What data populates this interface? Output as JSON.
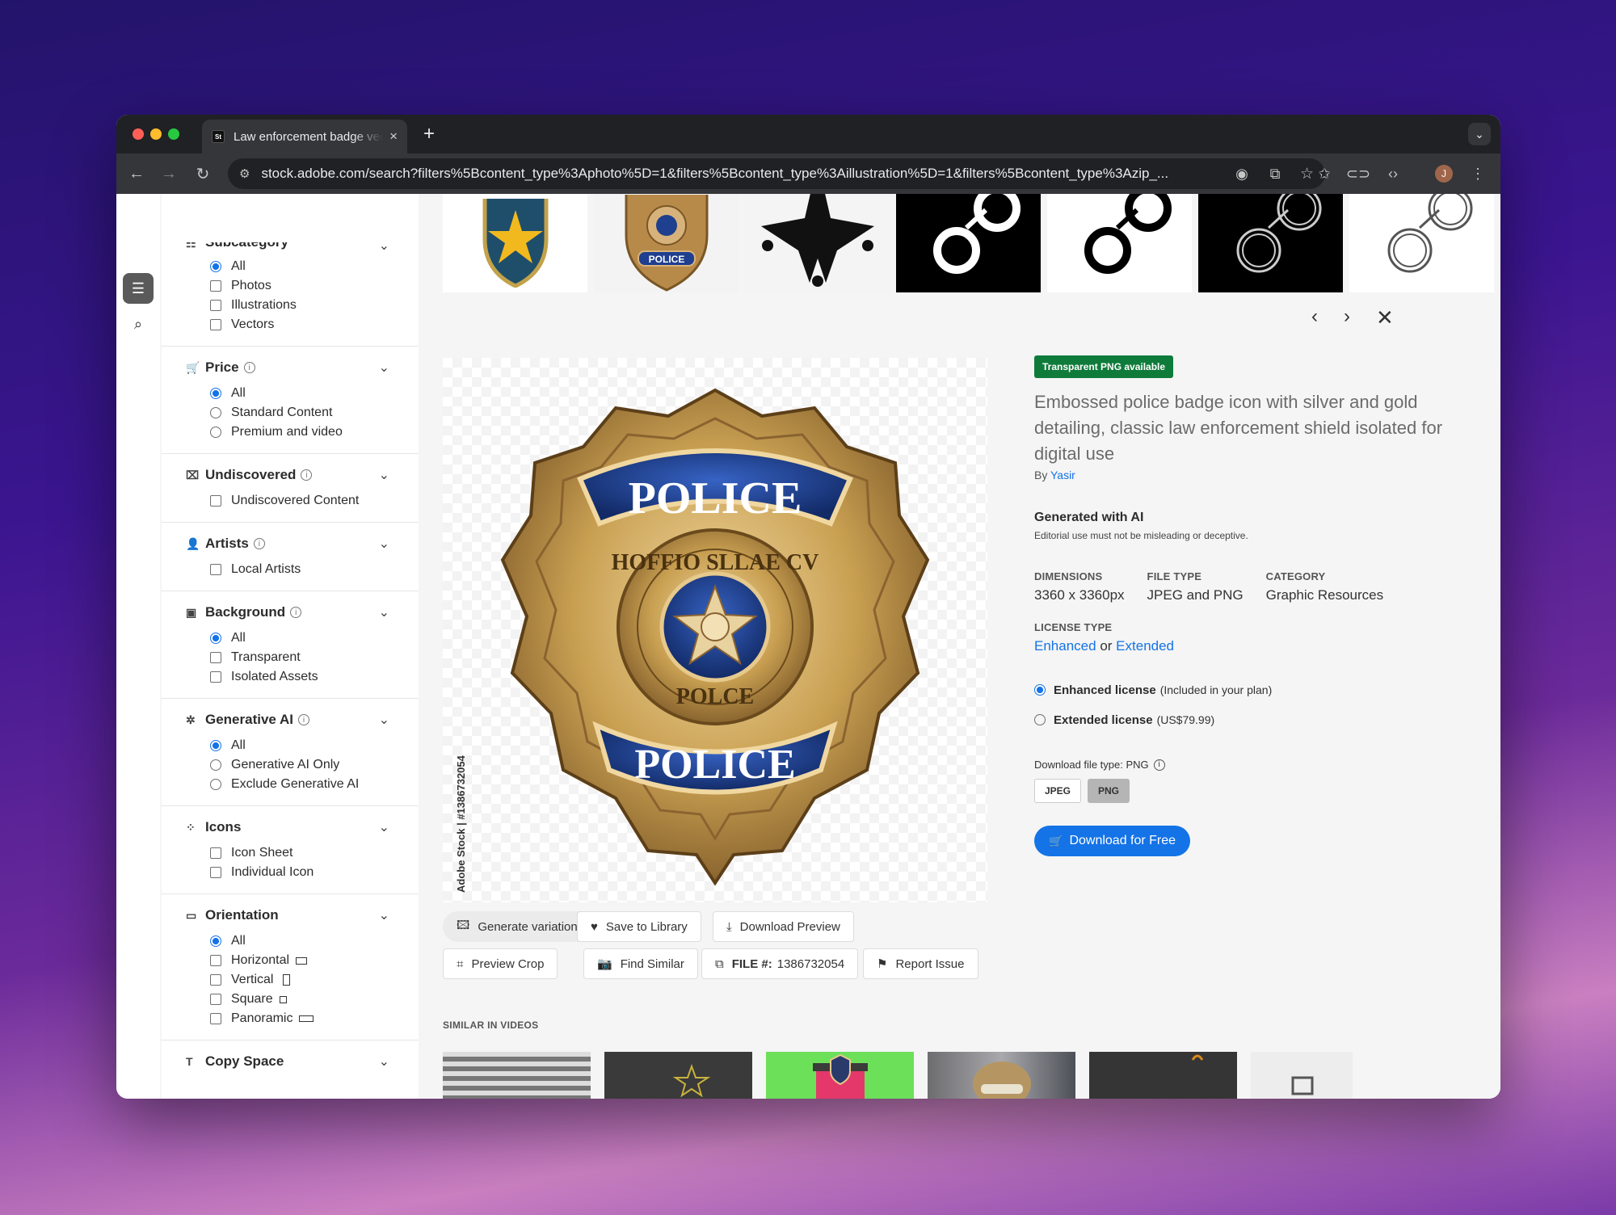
{
  "browser": {
    "tab_title": "Law enforcement badge vector",
    "tab_close": "×",
    "new_tab": "+",
    "url": "stock.adobe.com/search?filters%5Bcontent_type%3Aphoto%5D=1&filters%5Bcontent_type%3Aillustration%5D=1&filters%5Bcontent_type%3Azip_...",
    "profile_initial": "J",
    "favicon_text": "St"
  },
  "filters": {
    "subcategory": {
      "title": "Subcategory",
      "options": [
        "All",
        "Photos",
        "Illustrations",
        "Vectors"
      ]
    },
    "price": {
      "title": "Price",
      "options": [
        "All",
        "Standard Content",
        "Premium and video"
      ]
    },
    "undiscovered": {
      "title": "Undiscovered",
      "options": [
        "Undiscovered Content"
      ]
    },
    "artists": {
      "title": "Artists",
      "options": [
        "Local Artists"
      ]
    },
    "background": {
      "title": "Background",
      "options": [
        "All",
        "Transparent",
        "Isolated Assets"
      ]
    },
    "generative_ai": {
      "title": "Generative AI",
      "options": [
        "All",
        "Generative AI Only",
        "Exclude Generative AI"
      ]
    },
    "icons": {
      "title": "Icons",
      "options": [
        "Icon Sheet",
        "Individual Icon"
      ]
    },
    "orientation": {
      "title": "Orientation",
      "options": [
        "All",
        "Horizontal",
        "Vertical",
        "Square",
        "Panoramic"
      ]
    },
    "copy_space": {
      "title": "Copy Space"
    }
  },
  "asset": {
    "badge": "Transparent PNG available",
    "description": "Embossed police badge icon with silver and gold detailing, classic law enforcement shield isolated for digital use",
    "by_label": "By",
    "author": "Yasir",
    "generated_title": "Generated with AI",
    "generated_note": "Editorial use must not be misleading or deceptive.",
    "dimensions_label": "DIMENSIONS",
    "dimensions": "3360 x 3360px",
    "file_type_label": "FILE TYPE",
    "file_type": "JPEG and PNG",
    "category_label": "CATEGORY",
    "category": "Graphic Resources",
    "license_type_label": "LICENSE TYPE",
    "license_enhanced": "Enhanced",
    "license_or": "or",
    "license_extended": "Extended",
    "enhanced_option": "Enhanced license",
    "enhanced_note": "(Included in your plan)",
    "extended_option": "Extended license",
    "extended_note": "(US$79.99)",
    "download_type_label": "Download file type: PNG",
    "jpeg_label": "JPEG",
    "png_label": "PNG",
    "download_button": "Download for Free",
    "watermark": "Adobe Stock | #1386732054"
  },
  "actions": {
    "generate_variations": "Generate variations",
    "save_to_library": "Save to Library",
    "download_preview": "Download Preview",
    "preview_crop": "Preview Crop",
    "find_similar": "Find Similar",
    "file_label": "FILE #:",
    "file_number": "1386732054",
    "report_issue": "Report Issue"
  },
  "badge_art": {
    "top_text": "POLICE",
    "ring_text": "HOFFIO SLLAE CV",
    "inner_text": "POLCE",
    "bottom_text": "POLICE"
  },
  "similar_videos_label": "SIMILAR IN VIDEOS",
  "colors": {
    "accent": "#1473e6",
    "badge_green": "#0f7b3b",
    "badge_gold": "#c9a052",
    "badge_blue": "#1f3f8f"
  }
}
